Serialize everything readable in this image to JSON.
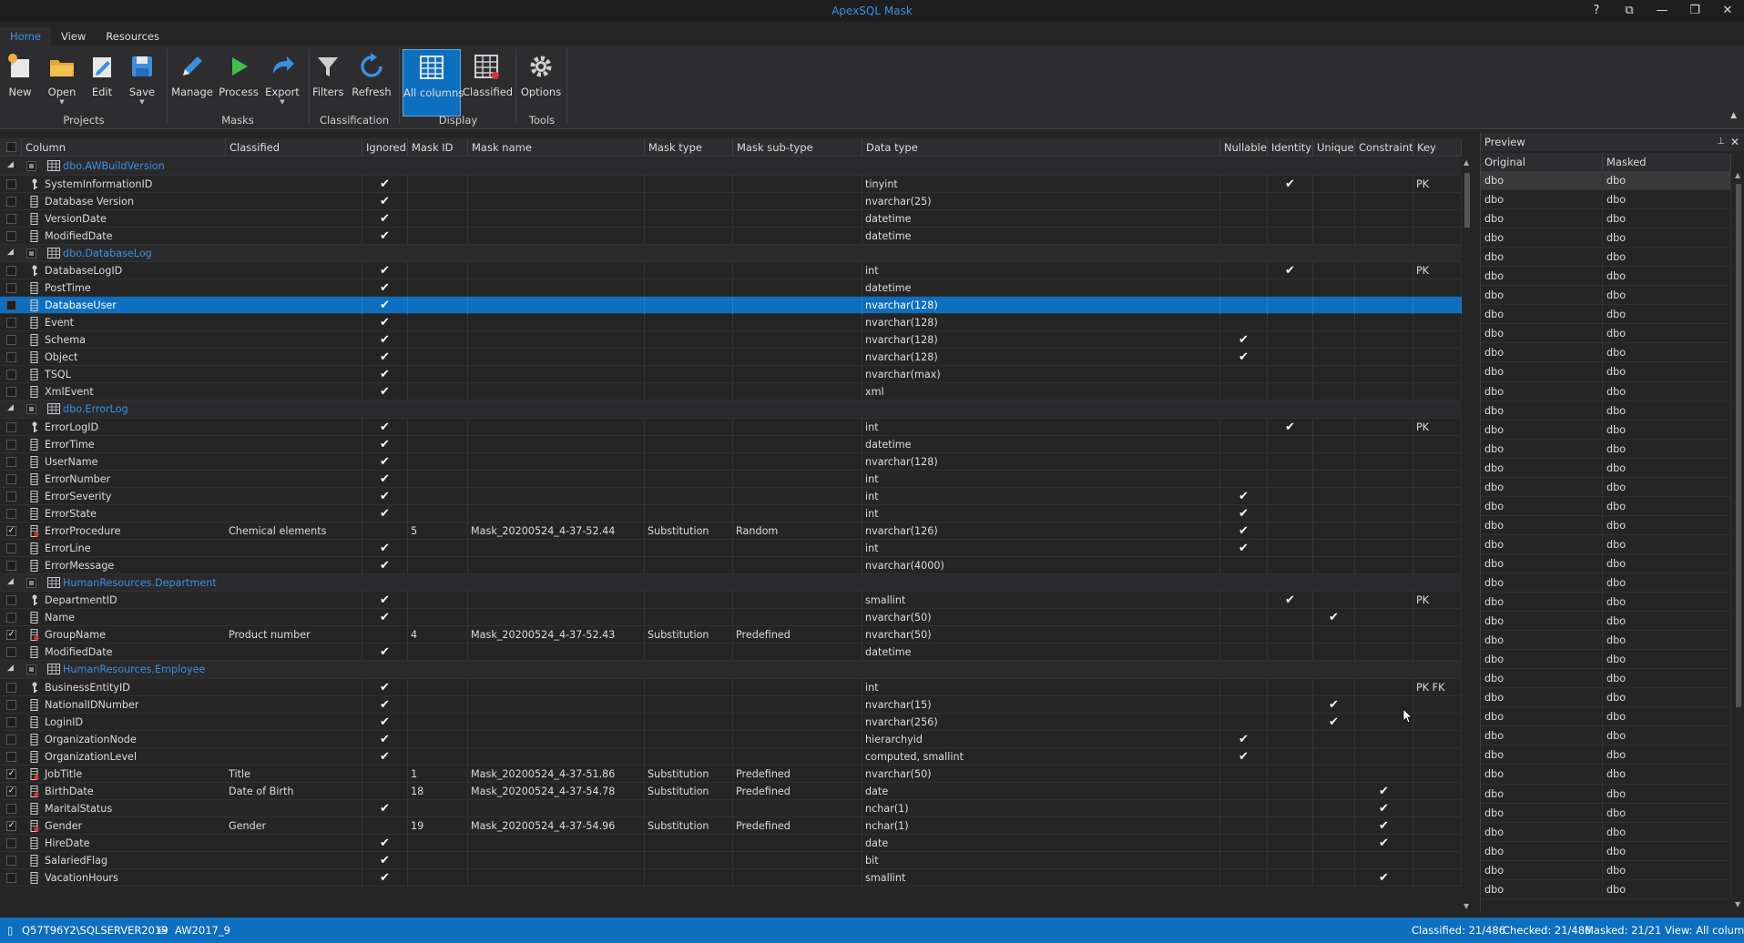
{
  "app": {
    "title": "ApexSQL Mask",
    "window_buttons": [
      "?",
      "⧉",
      "—",
      "❐",
      "✕"
    ]
  },
  "menu_tabs": [
    {
      "label": "Home",
      "active": true
    },
    {
      "label": "View"
    },
    {
      "label": "Resources"
    }
  ],
  "ribbon": {
    "buttons": {
      "new": "New",
      "open": "Open",
      "edit": "Edit",
      "save": "Save",
      "manage": "Manage",
      "process": "Process",
      "export": "Export",
      "filters": "Filters",
      "refresh": "Refresh",
      "all_columns": "All columns",
      "classified": "Classified",
      "options": "Options"
    },
    "groups": {
      "projects": "Projects",
      "masks": "Masks",
      "classification": "Classification",
      "display": "Display",
      "tools": "Tools"
    }
  },
  "grid": {
    "headers": {
      "column": "Column",
      "classified": "Classified",
      "ignored": "Ignored",
      "mask_id": "Mask ID",
      "mask_name": "Mask name",
      "mask_type": "Mask type",
      "mask_sub_type": "Mask sub-type",
      "data_type": "Data type",
      "nullable": "Nullable",
      "identity": "Identity",
      "unique": "Unique",
      "constraints": "Constraints",
      "key": "Key"
    },
    "rows": [
      {
        "group": "dbo.AWBuildVersion"
      },
      {
        "name": "SystemInformationID",
        "icon": "key",
        "ignored": true,
        "data_type": "tinyint",
        "identity": true,
        "key": "PK"
      },
      {
        "name": "Database Version",
        "icon": "col",
        "ignored": true,
        "data_type": "nvarchar(25)"
      },
      {
        "name": "VersionDate",
        "icon": "col",
        "ignored": true,
        "data_type": "datetime"
      },
      {
        "name": "ModifiedDate",
        "icon": "col",
        "ignored": true,
        "data_type": "datetime"
      },
      {
        "group": "dbo.DatabaseLog"
      },
      {
        "name": "DatabaseLogID",
        "icon": "key",
        "ignored": true,
        "data_type": "int",
        "identity": true,
        "key": "PK"
      },
      {
        "name": "PostTime",
        "icon": "col",
        "ignored": true,
        "data_type": "datetime"
      },
      {
        "name": "DatabaseUser",
        "icon": "col",
        "ignored": true,
        "data_type": "nvarchar(128)",
        "selected": true
      },
      {
        "name": "Event",
        "icon": "col",
        "ignored": true,
        "data_type": "nvarchar(128)"
      },
      {
        "name": "Schema",
        "icon": "col",
        "ignored": true,
        "data_type": "nvarchar(128)",
        "nullable": true
      },
      {
        "name": "Object",
        "icon": "col",
        "ignored": true,
        "data_type": "nvarchar(128)",
        "nullable": true
      },
      {
        "name": "TSQL",
        "icon": "col",
        "ignored": true,
        "data_type": "nvarchar(max)"
      },
      {
        "name": "XmlEvent",
        "icon": "col",
        "ignored": true,
        "data_type": "xml"
      },
      {
        "group": "dbo.ErrorLog"
      },
      {
        "name": "ErrorLogID",
        "icon": "key",
        "ignored": true,
        "data_type": "int",
        "identity": true,
        "key": "PK"
      },
      {
        "name": "ErrorTime",
        "icon": "col",
        "ignored": true,
        "data_type": "datetime"
      },
      {
        "name": "UserName",
        "icon": "col",
        "ignored": true,
        "data_type": "nvarchar(128)"
      },
      {
        "name": "ErrorNumber",
        "icon": "col",
        "ignored": true,
        "data_type": "int"
      },
      {
        "name": "ErrorSeverity",
        "icon": "col",
        "ignored": true,
        "data_type": "int",
        "nullable": true
      },
      {
        "name": "ErrorState",
        "icon": "col",
        "ignored": true,
        "data_type": "int",
        "nullable": true
      },
      {
        "name": "ErrorProcedure",
        "icon": "masked",
        "checked": true,
        "classified": "Chemical elements",
        "mask_id": "5",
        "mask_name": "Mask_20200524_4-37-52.44",
        "mask_type": "Substitution",
        "mask_sub_type": "Random",
        "data_type": "nvarchar(126)",
        "nullable": true
      },
      {
        "name": "ErrorLine",
        "icon": "col",
        "ignored": true,
        "data_type": "int",
        "nullable": true
      },
      {
        "name": "ErrorMessage",
        "icon": "col",
        "ignored": true,
        "data_type": "nvarchar(4000)"
      },
      {
        "group": "HumanResources.Department"
      },
      {
        "name": "DepartmentID",
        "icon": "key",
        "ignored": true,
        "data_type": "smallint",
        "identity": true,
        "key": "PK"
      },
      {
        "name": "Name",
        "icon": "col",
        "ignored": true,
        "data_type": "nvarchar(50)",
        "unique": true
      },
      {
        "name": "GroupName",
        "icon": "masked",
        "checked": true,
        "classified": "Product number",
        "mask_id": "4",
        "mask_name": "Mask_20200524_4-37-52.43",
        "mask_type": "Substitution",
        "mask_sub_type": "Predefined",
        "data_type": "nvarchar(50)"
      },
      {
        "name": "ModifiedDate",
        "icon": "col",
        "ignored": true,
        "data_type": "datetime"
      },
      {
        "group": "HumanResources.Employee"
      },
      {
        "name": "BusinessEntityID",
        "icon": "key",
        "ignored": true,
        "data_type": "int",
        "key": "PK FK"
      },
      {
        "name": "NationalIDNumber",
        "icon": "col",
        "ignored": true,
        "data_type": "nvarchar(15)",
        "unique": true
      },
      {
        "name": "LoginID",
        "icon": "col",
        "ignored": true,
        "data_type": "nvarchar(256)",
        "unique": true
      },
      {
        "name": "OrganizationNode",
        "icon": "col",
        "ignored": true,
        "data_type": "hierarchyid",
        "nullable": true
      },
      {
        "name": "OrganizationLevel",
        "icon": "col",
        "ignored": true,
        "data_type": "computed, smallint",
        "nullable": true
      },
      {
        "name": "JobTitle",
        "icon": "masked",
        "checked": true,
        "classified": "Title",
        "mask_id": "1",
        "mask_name": "Mask_20200524_4-37-51.86",
        "mask_type": "Substitution",
        "mask_sub_type": "Predefined",
        "data_type": "nvarchar(50)"
      },
      {
        "name": "BirthDate",
        "icon": "masked",
        "checked": true,
        "classified": "Date of Birth",
        "mask_id": "18",
        "mask_name": "Mask_20200524_4-37-54.78",
        "mask_type": "Substitution",
        "mask_sub_type": "Predefined",
        "data_type": "date",
        "constraints": true
      },
      {
        "name": "MaritalStatus",
        "icon": "col",
        "ignored": true,
        "data_type": "nchar(1)",
        "constraints": true
      },
      {
        "name": "Gender",
        "icon": "masked",
        "checked": true,
        "classified": "Gender",
        "mask_id": "19",
        "mask_name": "Mask_20200524_4-37-54.96",
        "mask_type": "Substitution",
        "mask_sub_type": "Predefined",
        "data_type": "nchar(1)",
        "constraints": true
      },
      {
        "name": "HireDate",
        "icon": "col",
        "ignored": true,
        "data_type": "date",
        "constraints": true
      },
      {
        "name": "SalariedFlag",
        "icon": "col",
        "ignored": true,
        "data_type": "bit"
      },
      {
        "name": "VacationHours",
        "icon": "col",
        "ignored": true,
        "data_type": "smallint",
        "constraints": true
      }
    ]
  },
  "preview": {
    "title": "Preview",
    "headers": {
      "original": "Original",
      "masked": "Masked"
    },
    "rows": [
      [
        "dbo",
        "dbo"
      ],
      [
        "dbo",
        "dbo"
      ],
      [
        "dbo",
        "dbo"
      ],
      [
        "dbo",
        "dbo"
      ],
      [
        "dbo",
        "dbo"
      ],
      [
        "dbo",
        "dbo"
      ],
      [
        "dbo",
        "dbo"
      ],
      [
        "dbo",
        "dbo"
      ],
      [
        "dbo",
        "dbo"
      ],
      [
        "dbo",
        "dbo"
      ],
      [
        "dbo",
        "dbo"
      ],
      [
        "dbo",
        "dbo"
      ],
      [
        "dbo",
        "dbo"
      ],
      [
        "dbo",
        "dbo"
      ],
      [
        "dbo",
        "dbo"
      ],
      [
        "dbo",
        "dbo"
      ],
      [
        "dbo",
        "dbo"
      ],
      [
        "dbo",
        "dbo"
      ],
      [
        "dbo",
        "dbo"
      ],
      [
        "dbo",
        "dbo"
      ],
      [
        "dbo",
        "dbo"
      ],
      [
        "dbo",
        "dbo"
      ],
      [
        "dbo",
        "dbo"
      ],
      [
        "dbo",
        "dbo"
      ],
      [
        "dbo",
        "dbo"
      ],
      [
        "dbo",
        "dbo"
      ],
      [
        "dbo",
        "dbo"
      ],
      [
        "dbo",
        "dbo"
      ],
      [
        "dbo",
        "dbo"
      ],
      [
        "dbo",
        "dbo"
      ],
      [
        "dbo",
        "dbo"
      ],
      [
        "dbo",
        "dbo"
      ],
      [
        "dbo",
        "dbo"
      ],
      [
        "dbo",
        "dbo"
      ],
      [
        "dbo",
        "dbo"
      ],
      [
        "dbo",
        "dbo"
      ],
      [
        "dbo",
        "dbo"
      ],
      [
        "dbo",
        "dbo"
      ]
    ]
  },
  "statusbar": {
    "server": "Q57T96Y2\\SQLSERVER2019",
    "database": "AW2017_9",
    "classified": "Classified: 21/486",
    "checked": "Checked: 21/486",
    "masked": "Masked: 21/21",
    "view": "View: All columns"
  },
  "colors": {
    "accent": "#0d6fbf",
    "link": "#3c8fe0",
    "background": "#252526",
    "masked_marker": "#e03030"
  }
}
